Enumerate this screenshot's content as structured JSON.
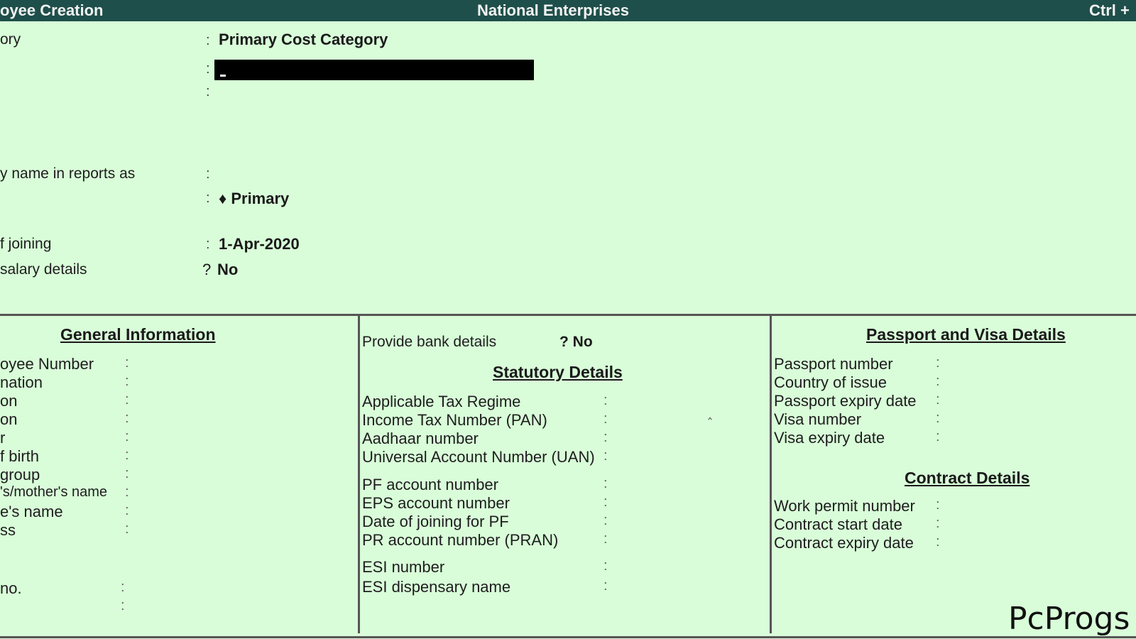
{
  "titlebar": {
    "left": "oyee  Creation",
    "center": "National Enterprises",
    "right": "Ctrl +"
  },
  "top_form": {
    "category_label": "ory",
    "category_value": "Primary Cost Category",
    "display_name_label": "y name in reports as",
    "under_value": "♦ Primary",
    "joining_label": "f joining",
    "joining_value": "1-Apr-2020",
    "salary_label": " salary details",
    "salary_prompt": "?",
    "salary_value": "No"
  },
  "general": {
    "heading": "General Information",
    "fields": [
      "oyee Number",
      "nation",
      "on",
      "on",
      "r",
      "f birth",
      " group",
      "'s/mother's name",
      "e's name",
      "ss"
    ],
    "phone_label": " no."
  },
  "middle": {
    "bank_label": "Provide bank details",
    "bank_value": "? No",
    "heading": "Statutory Details",
    "group1": [
      "Applicable Tax Regime",
      "Income Tax Number (PAN)",
      "Aadhaar number",
      "Universal Account Number (UAN)"
    ],
    "group2": [
      "PF account number",
      "EPS account number",
      "Date of joining for PF",
      "PR account number (PRAN)"
    ],
    "group3": [
      "ESI number",
      "ESI dispensary name"
    ]
  },
  "right": {
    "passport_heading": "Passport and Visa Details",
    "passport_fields": [
      "Passport number",
      "Country of issue",
      "Passport expiry date",
      "Visa number",
      "Visa expiry date"
    ],
    "contract_heading": "Contract Details",
    "contract_fields": [
      "Work permit number",
      "Contract start date",
      "Contract expiry date"
    ]
  },
  "watermark": "PcProgs"
}
